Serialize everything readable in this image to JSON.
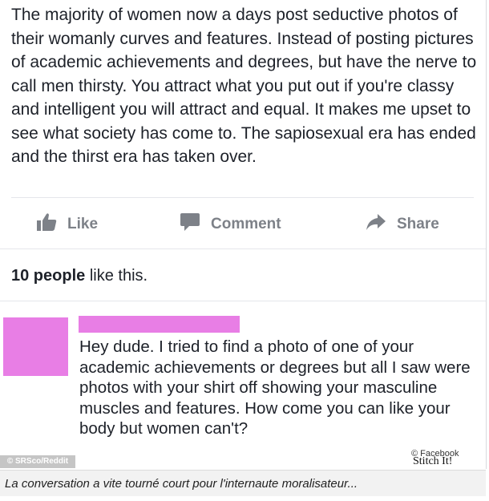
{
  "post": {
    "text": "The majority of women now a days post seductive photos of their womanly curves and features. Instead of posting pictures of academic  achievements and degrees, but have the nerve to call men thirsty. You attract what you put out if you're classy and intelligent you will attract and equal. It makes me upset to see what society has come to. The sapiosexual era has ended and the thirst era has taken over."
  },
  "actions": {
    "like": "Like",
    "comment": "Comment",
    "share": "Share"
  },
  "likes": {
    "count_text": "10 people",
    "suffix": " like this."
  },
  "comment": {
    "text": "Hey dude. I tried to find a photo of one of your academic achievements or degrees but all I saw were photos with your shirt off showing your masculine muscles and features. How come you can like your body but women can't?"
  },
  "credit": "© SRSco/Reddit",
  "watermark": {
    "source": "© Facebook",
    "brand": "Stitch It!"
  },
  "caption": "La conversation a vite tourné court pour l'internaute moralisateur...",
  "colors": {
    "redaction": "#e87ee5",
    "action_gray": "#7d8188"
  }
}
